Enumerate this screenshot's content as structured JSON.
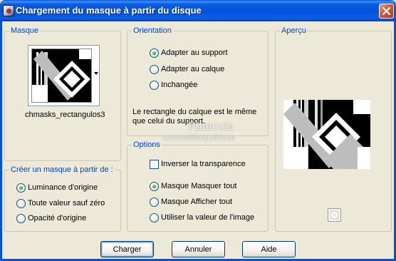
{
  "window": {
    "title": "Chargement du masque à partir du disque"
  },
  "masque": {
    "legend": "Masque",
    "file_name": "chmasks_rectangulos3"
  },
  "creer": {
    "legend": "Créer un masque à partir de :",
    "options": [
      {
        "label": "Luminance d'origine",
        "checked": true
      },
      {
        "label": "Toute valeur sauf zéro",
        "checked": false
      },
      {
        "label": "Opacité d'origine",
        "checked": false
      }
    ]
  },
  "orientation": {
    "legend": "Orientation",
    "options": [
      {
        "label": "Adapter au support",
        "checked": true
      },
      {
        "label": "Adapter au calque",
        "checked": false
      },
      {
        "label": "Inchangée",
        "checked": false
      }
    ],
    "description": "Le rectangle du calque est le même que celui du support."
  },
  "options": {
    "legend": "Options",
    "invert_label": "Inverser la transparence",
    "invert_checked": false,
    "radios": [
      {
        "label": "Masque Masquer tout",
        "checked": true
      },
      {
        "label": "Masque Afficher tout",
        "checked": false
      },
      {
        "label": "Utiliser la valeur de l'image",
        "checked": false
      }
    ]
  },
  "apercu": {
    "legend": "Aperçu"
  },
  "watermark": {
    "name": "Pinuccia",
    "url": "www.maidiregrafica.eu"
  },
  "buttons": {
    "charger": "Charger",
    "annuler": "Annuler",
    "aide": "Aide"
  },
  "colors": {
    "titlebar": "#0a5ce0",
    "dialog_bg": "#ece9d8",
    "legend_text": "#0046d5"
  }
}
